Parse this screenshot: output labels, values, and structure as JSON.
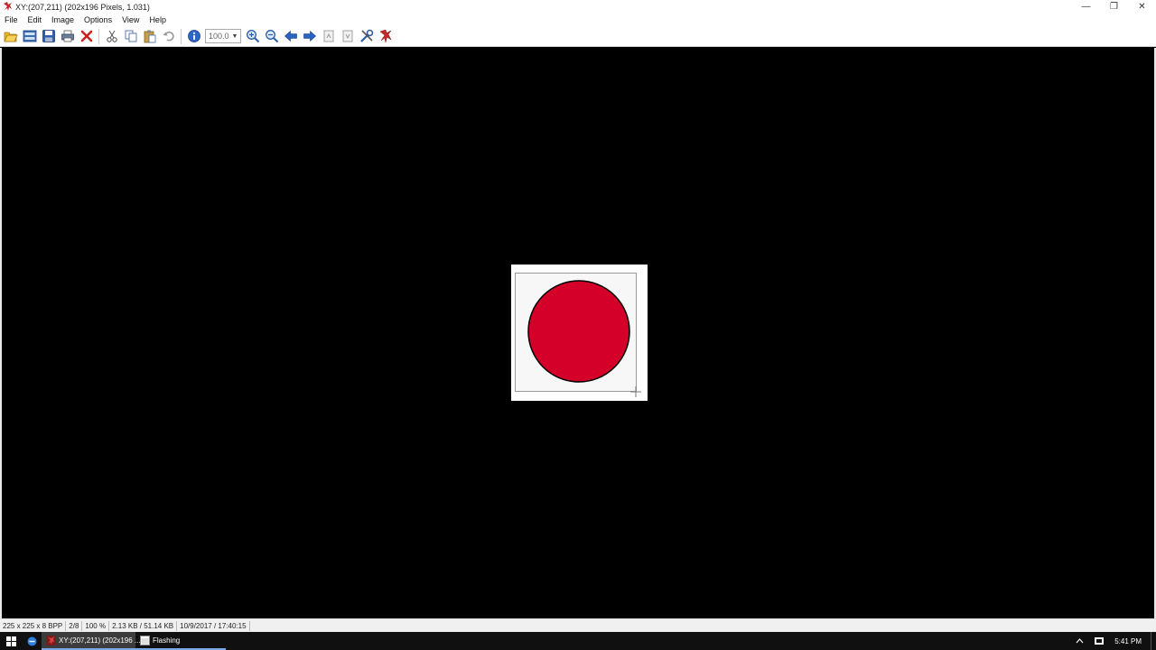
{
  "window": {
    "title": "XY:(207,211) (202x196 Pixels, 1.031)",
    "minimize_glyph": "—",
    "restore_glyph": "❐",
    "close_glyph": "✕"
  },
  "menu": {
    "items": [
      "File",
      "Edit",
      "Image",
      "Options",
      "View",
      "Help"
    ]
  },
  "toolbar": {
    "zoom_value": "100.0",
    "icons": [
      "open-folder-icon",
      "thumbnails-icon",
      "save-icon",
      "print-icon",
      "delete-icon",
      "cut-icon",
      "copy-icon",
      "paste-icon",
      "undo-icon",
      "info-icon",
      "zoom-in-icon",
      "zoom-out-icon",
      "previous-icon",
      "next-icon",
      "first-page-icon",
      "last-page-icon",
      "settings-icon",
      "app-logo-icon"
    ]
  },
  "image": {
    "circle_fill": "#d4002a",
    "circle_stroke": "#000000",
    "background": "#f7f7f7"
  },
  "status": {
    "dimensions": "225 x 225 x 8 BPP",
    "page": "2/8",
    "zoom": "100 %",
    "size": "2.13 KB / 51.14 KB",
    "datetime": "10/9/2017 / 17:40:15"
  },
  "taskbar": {
    "tasks": [
      {
        "label": "XY:(207,211) (202x196 ..."
      },
      {
        "label": "Flashing"
      }
    ],
    "clock": "5:41 PM"
  },
  "colors": {
    "accent": "#7aa8e6",
    "taskbar": "#101010"
  }
}
